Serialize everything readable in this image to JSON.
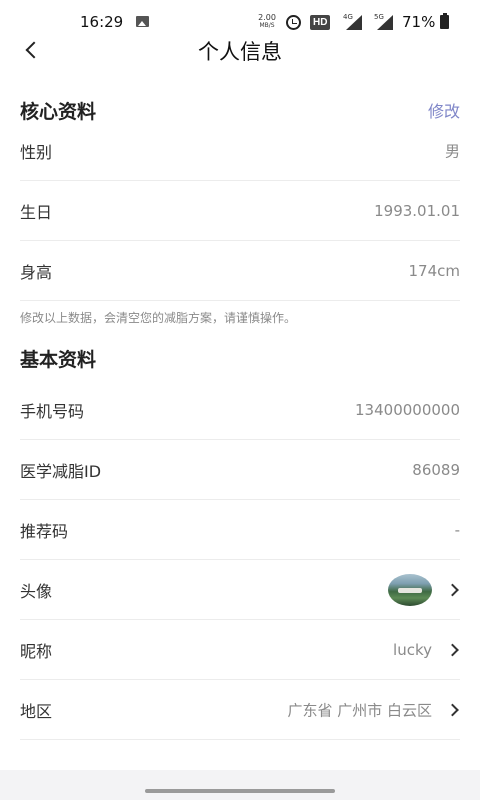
{
  "status_bar": {
    "time": "16:29",
    "net_speed_value": "2.00",
    "net_speed_unit": "MB/S",
    "hd_label": "HD",
    "sim1_label": "4G",
    "sim2_label": "5G",
    "battery": "71%",
    "icons": [
      "image-icon",
      "alarm-icon",
      "signal-icon",
      "battery-icon"
    ]
  },
  "header": {
    "title": "个人信息",
    "back_icon": "chevron-left-icon"
  },
  "core_section": {
    "title": "核心资料",
    "edit_label": "修改",
    "rows": [
      {
        "label": "性别",
        "value": "男"
      },
      {
        "label": "生日",
        "value": "1993.01.01"
      },
      {
        "label": "身高",
        "value": "174cm"
      }
    ],
    "note": "修改以上数据，会清空您的减脂方案，请谨慎操作。"
  },
  "basic_section": {
    "title": "基本资料",
    "rows": [
      {
        "label": "手机号码",
        "value": "13400000000"
      },
      {
        "label": "医学减脂ID",
        "value": "86089"
      },
      {
        "label": "推荐码",
        "value": "-"
      },
      {
        "label": "头像",
        "value": ""
      },
      {
        "label": "昵称",
        "value": "lucky"
      },
      {
        "label": "地区",
        "value": "广东省 广州市 白云区"
      }
    ]
  },
  "colors": {
    "accent": "#7f86c8",
    "value_text": "#8a8a8a",
    "divider": "#ececec"
  }
}
